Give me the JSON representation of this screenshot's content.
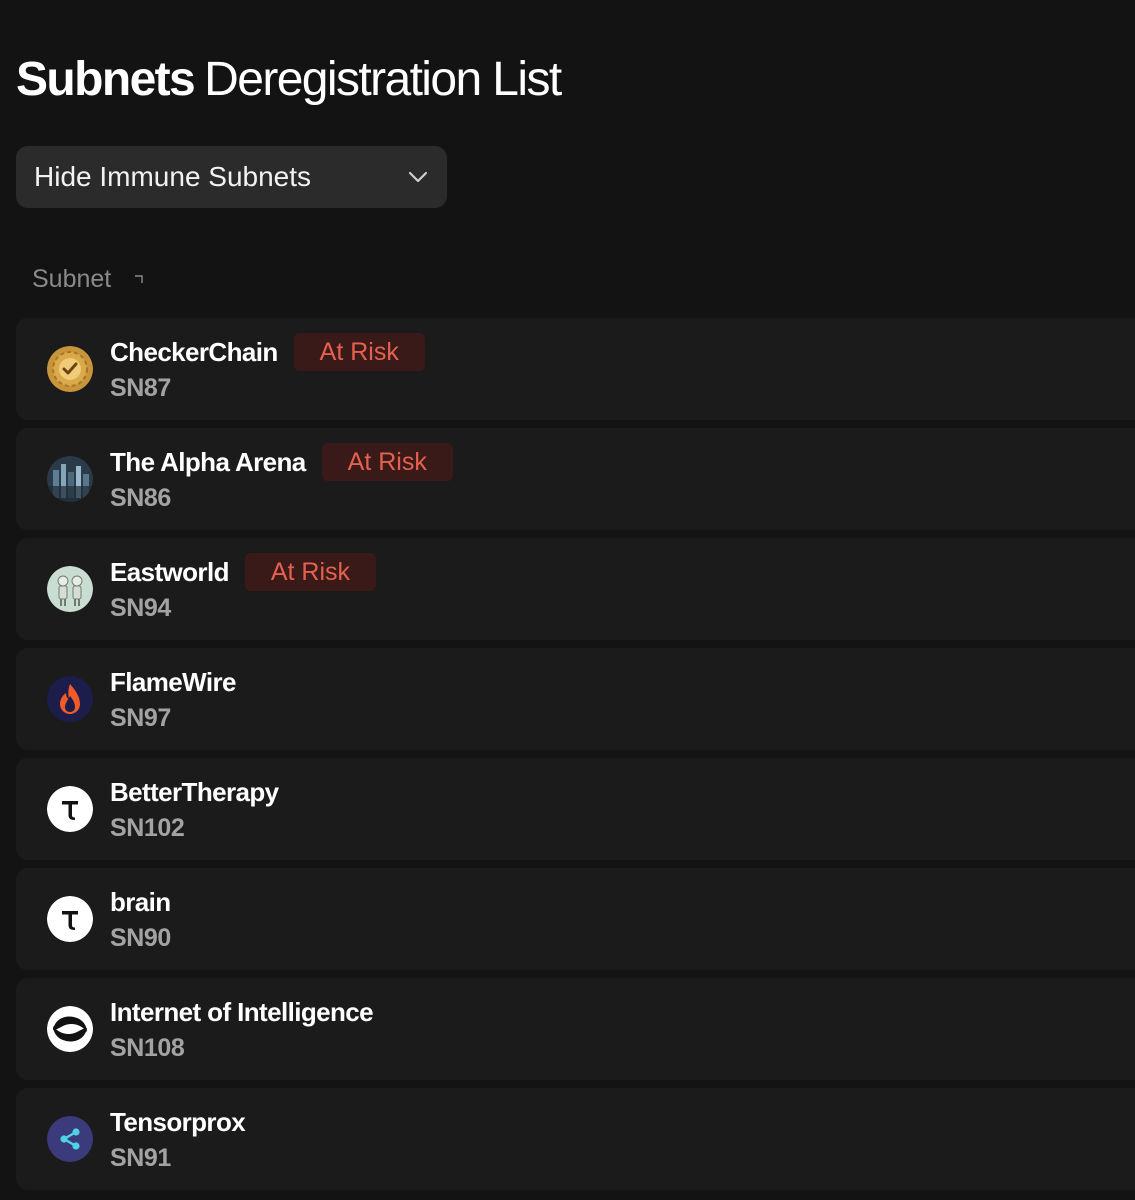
{
  "header": {
    "title_bold": "Subnets",
    "title_light": "Deregistration List"
  },
  "filter": {
    "selected": "Hide Immune Subnets"
  },
  "table": {
    "column_header": "Subnet",
    "rows": [
      {
        "name": "CheckerChain",
        "sn": "SN87",
        "badge": "At Risk",
        "icon": "gear-check-icon"
      },
      {
        "name": "The Alpha Arena",
        "sn": "SN86",
        "badge": "At Risk",
        "icon": "city-icon"
      },
      {
        "name": "Eastworld",
        "sn": "SN94",
        "badge": "At Risk",
        "icon": "robots-icon"
      },
      {
        "name": "FlameWire",
        "sn": "SN97",
        "badge": "",
        "icon": "flame-icon"
      },
      {
        "name": "BetterTherapy",
        "sn": "SN102",
        "badge": "",
        "icon": "tao-icon"
      },
      {
        "name": "brain",
        "sn": "SN90",
        "badge": "",
        "icon": "tao-icon"
      },
      {
        "name": "Internet of Intelligence",
        "sn": "SN108",
        "badge": "",
        "icon": "swirl-icon"
      },
      {
        "name": "Tensorprox",
        "sn": "SN91",
        "badge": "",
        "icon": "share-icon"
      }
    ]
  },
  "colors": {
    "background": "#131313",
    "row_background": "#1b1b1b",
    "badge_background": "#3a1a19",
    "badge_text": "#e4614f",
    "muted_text": "#a3a3a3"
  }
}
